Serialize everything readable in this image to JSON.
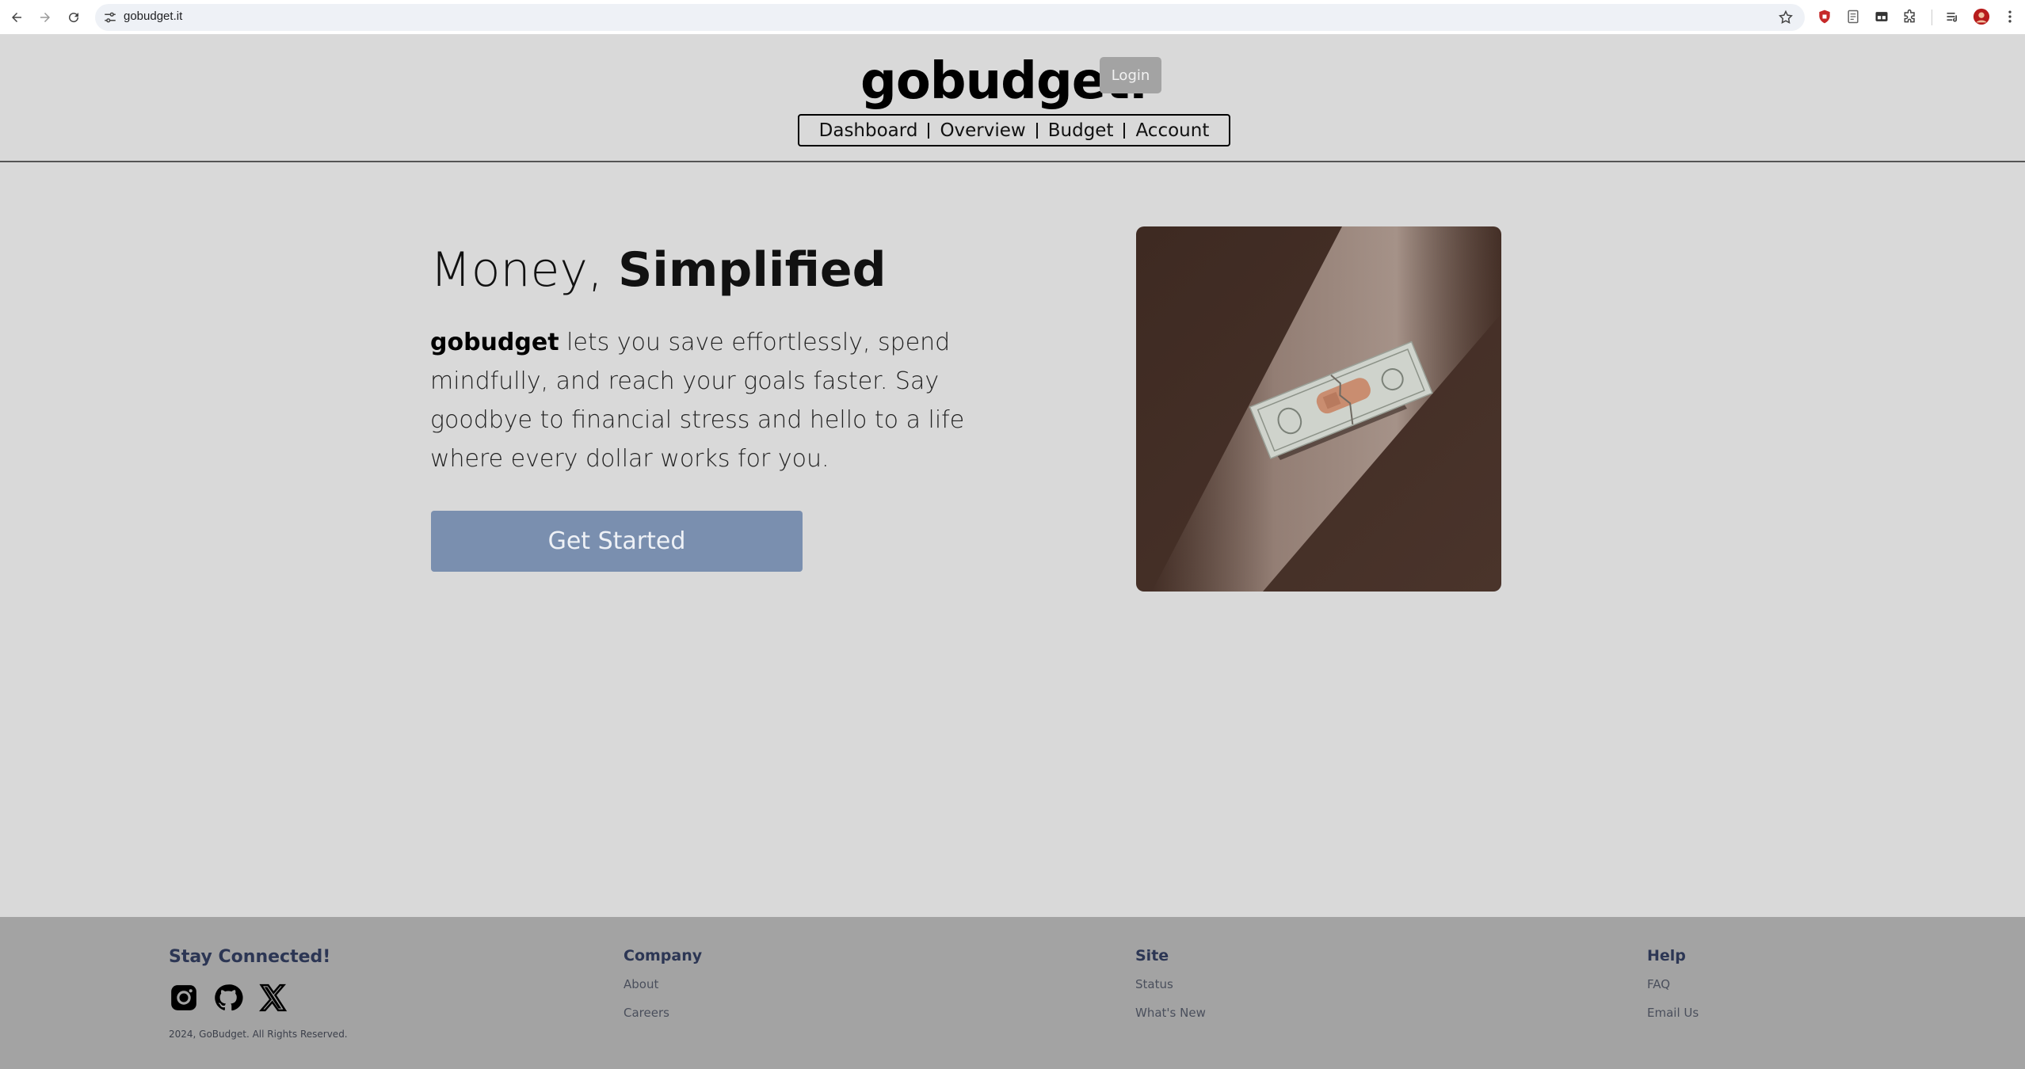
{
  "browser": {
    "url": "gobudget.it",
    "icons": [
      "back-icon",
      "forward-icon",
      "reload-icon",
      "site-settings-icon",
      "bookmark-star-icon",
      "extension-shield-icon",
      "extension-doc-icon",
      "extension-tab-icon",
      "extensions-puzzle-icon",
      "media-queue-icon",
      "profile-avatar-icon",
      "menu-dots-icon"
    ]
  },
  "header": {
    "brand": "gobudget.",
    "login_label": "Login",
    "nav": [
      "Dashboard",
      "Overview",
      "Budget",
      "Account"
    ]
  },
  "hero": {
    "title_light": "Money, ",
    "title_bold": "Simplified",
    "description_brand": "gobudget",
    "description_rest": " lets you save effortlessly, spend mindfully, and reach your goals faster. Say goodbye to financial stress and hello to a life where every dollar works for you.",
    "cta_label": "Get Started",
    "image_desc": "dollar-bill-with-bandage"
  },
  "footer": {
    "stay_connected": "Stay Connected!",
    "social": [
      "instagram-icon",
      "github-icon",
      "x-icon"
    ],
    "copyright": "2024, GoBudget. All Rights Reserved.",
    "columns": [
      {
        "heading": "Company",
        "links": [
          "About",
          "Careers"
        ]
      },
      {
        "heading": "Site",
        "links": [
          "Status",
          "What's New"
        ]
      },
      {
        "heading": "Help",
        "links": [
          "FAQ",
          "Email Us"
        ]
      }
    ]
  },
  "colors": {
    "page_bg": "#d9d9d9",
    "footer_bg": "#a3a3a3",
    "cta_bg": "#7a8faf",
    "login_bg": "#a3a3a3",
    "footer_heading": "#2c3654"
  }
}
